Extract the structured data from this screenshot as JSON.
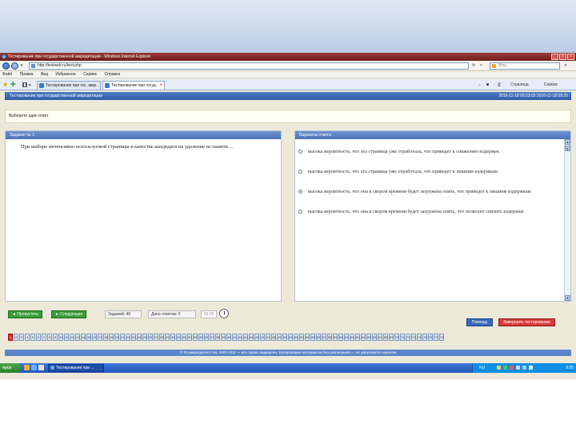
{
  "browser": {
    "title": "Тестирование при государственной аккредитации - Windows Internet Explorer",
    "url": "http://testweb.ru/test.php",
    "search_placeholder": "Bing",
    "menu": [
      "Файл",
      "Правка",
      "Вид",
      "Избранное",
      "Сервис",
      "Справка"
    ],
    "tabs": [
      {
        "label": "Тестирование при гос. аккр."
      },
      {
        "label": "Тестирование при госуд..."
      }
    ],
    "command_bar": [
      "Страница",
      "Сервис"
    ]
  },
  "app": {
    "header_title": "Тестирование при государственной аккредитации",
    "header_date": "2016-11-18 09:23:05 2016-11-18 09:25",
    "prompt": "Выберите один ответ",
    "task_panel_title": "Задание № 1.",
    "question": "При выборе интенсивно используемой страницы в качестве кандидата на удаление из памяти ...",
    "answers_panel_title": "Варианты ответа:",
    "options": [
      {
        "text": "высока вероятность, что эта страница уже отработала, что приведет к снижению издержек",
        "checked": false
      },
      {
        "text": "высока вероятность, что эта страница уже отработала, что приведет к лишним издержкам",
        "checked": false
      },
      {
        "text": "высока вероятность, что она в скором времени будет загружена опять, что приведет к лишним издержкам",
        "checked": true
      },
      {
        "text": "высока вероятность, что она в скором времени будет загружена опять, что позволит снизить издержки",
        "checked": false
      }
    ],
    "btn_prev": "◄ Пропустить",
    "btn_next": "► Следующее",
    "counter_tasks": "Заданий: 40",
    "counter_answered": "Дано ответов: 0",
    "timer": "32:26",
    "btn_help": "Помощь",
    "btn_finish": "Завершить тестирование",
    "question_numbers": [
      "1",
      "2",
      "3",
      "4",
      "5",
      "6",
      "7",
      "8",
      "9",
      "10",
      "11",
      "12",
      "13",
      "14",
      "15",
      "16",
      "17",
      "18",
      "19",
      "20",
      "21",
      "22",
      "23",
      "24",
      "25",
      "26",
      "27",
      "28",
      "29",
      "30",
      "31",
      "32",
      "33",
      "34",
      "35",
      "36",
      "37",
      "38",
      "39",
      "40",
      "41",
      "42",
      "43",
      "44",
      "45",
      "46",
      "47",
      "48",
      "49",
      "50",
      "51",
      "52",
      "53",
      "54",
      "55",
      "56",
      "57",
      "58",
      "59",
      "60",
      "61",
      "62",
      "63",
      "64",
      "65",
      "66",
      "67",
      "68",
      "69",
      "70",
      "71",
      "72",
      "73",
      "74",
      "75",
      "76",
      "77",
      "78"
    ],
    "footer": "© Росаккредагентство, 2003-2011 — все права защищены. Копирование материалов без разрешения — не допускается законом"
  },
  "taskbar": {
    "start": "пуск",
    "item": "Тестирование при ...",
    "lang": "RU",
    "clock": "9:25"
  },
  "colors": {
    "titlebar": "#8a2e28",
    "header_blue": "#2f5ea9",
    "panel_header": "#4b74bb",
    "green_button": "#3a9c3a",
    "red_button": "#d63b3b",
    "current_question": "#dd3333"
  }
}
